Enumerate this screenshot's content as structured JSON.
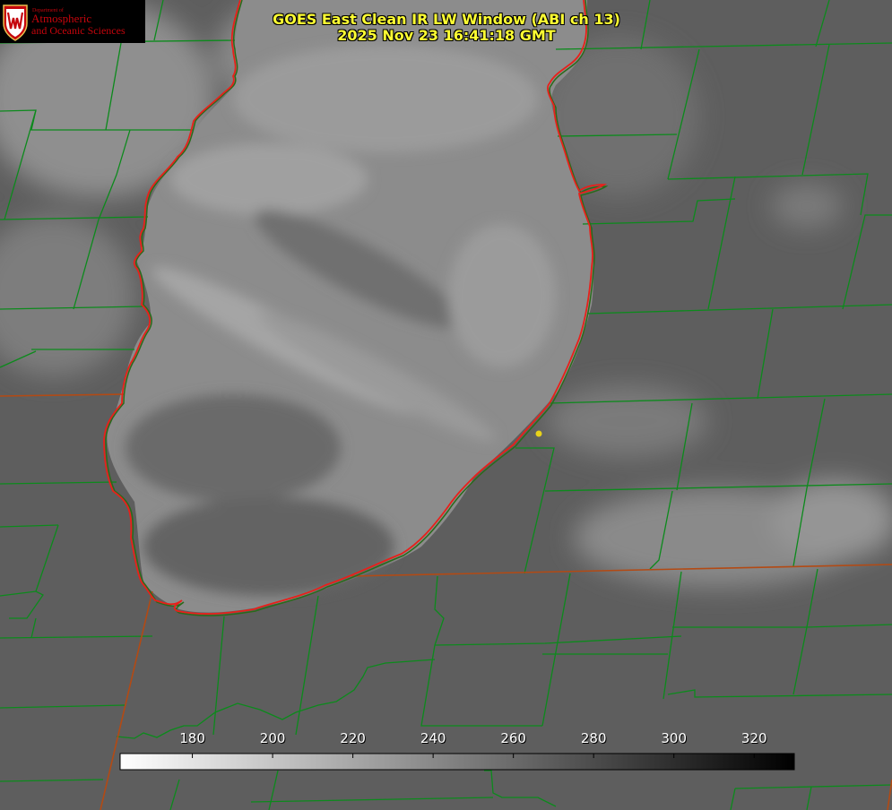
{
  "header": {
    "title_line1": "GOES East Clean IR LW Window (ABI ch 13)",
    "title_line2": "2025 Nov 23 16:41:18 GMT"
  },
  "logo": {
    "department": "Department of",
    "line1": "Atmospheric",
    "line2": "and Oceanic Sciences",
    "crest_letter": "W"
  },
  "colorbar": {
    "tick_values": [
      180,
      200,
      220,
      240,
      260,
      280,
      300,
      320
    ],
    "tick_labels": [
      "180",
      "200",
      "220",
      "240",
      "260",
      "280",
      "300",
      "320"
    ],
    "min": 162,
    "max": 330,
    "cold_color": "#ffffff",
    "warm_color": "#000000"
  },
  "colors": {
    "title": "#ffff33",
    "county_lines": "#0c8a1c",
    "state_lines": "#b34a14",
    "lake_outline": "#e8201a",
    "marker": "#e8d21a",
    "logo_red": "#c5050c"
  }
}
